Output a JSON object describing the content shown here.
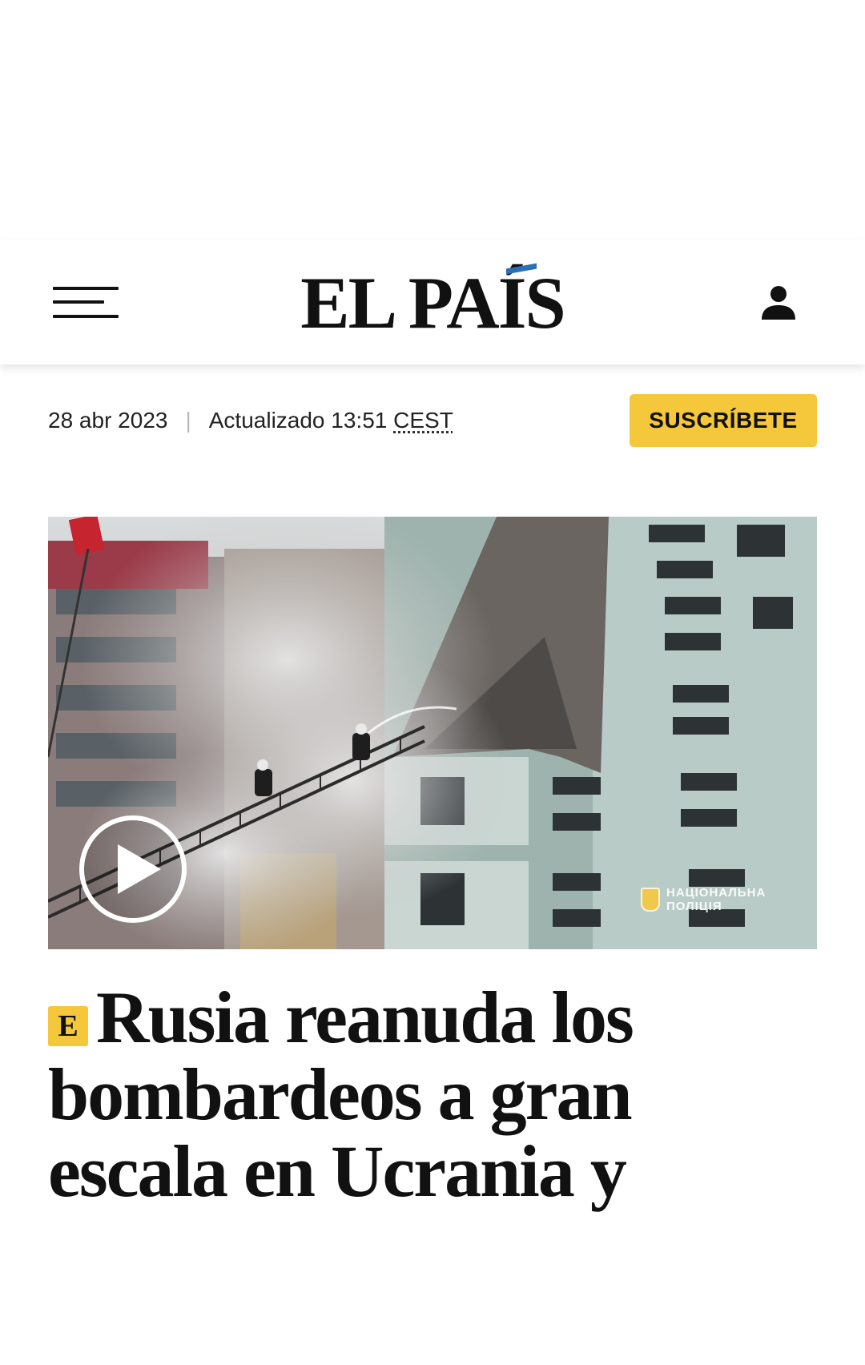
{
  "header": {
    "logo_text": "EL PAÍS",
    "menu_icon": "hamburger-menu-icon",
    "user_icon": "user-icon"
  },
  "meta": {
    "date": "28 abr 2023",
    "separator": "|",
    "updated_label": "Actualizado 13:51",
    "timezone": "CEST"
  },
  "subscribe_label": "SUSCRÍBETE",
  "video": {
    "play_icon": "play-icon",
    "watermark_line1": "НАЦІОНАЛЬНА",
    "watermark_line2": "ПОЛІЦІЯ"
  },
  "article": {
    "badge": "E",
    "headline": "Rusia reanuda los bombardeos a gran escala en Ucrania y"
  },
  "colors": {
    "accent_yellow": "#f5c83b",
    "logo_accent_blue": "#2d6fb5",
    "text": "#111111"
  }
}
